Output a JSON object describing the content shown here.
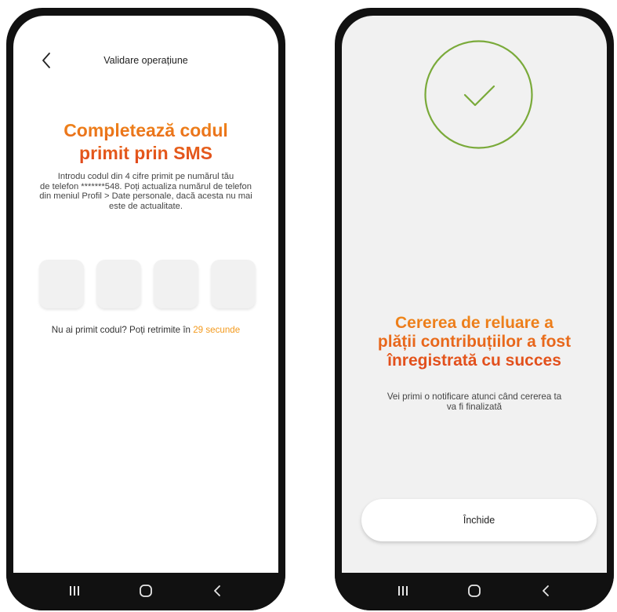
{
  "colors": {
    "accent_orange": "#f39a1e",
    "headline_top": "#f08a1a",
    "headline_bottom": "#e0461c",
    "success_green": "#7aaa3a",
    "otp_box_bg": "#f1f1f1"
  },
  "screen_otp": {
    "header_title": "Validare operațiune",
    "back_icon": "chevron-left-icon",
    "headline_line1": "Completează codul",
    "headline_line2": "primit prin SMS",
    "description_lines": [
      "Introdu codul din 4 cifre primit pe numărul tău",
      "de telefon *******548. Poți actualiza numărul de telefon",
      "din meniul Profil > Date personale, dacă acesta nu mai",
      "este de actualitate."
    ],
    "otp_digits": [
      "",
      "",
      "",
      ""
    ],
    "resend_text": "Nu ai primit codul? Poți retrimite în",
    "resend_countdown": "29 secunde"
  },
  "screen_success": {
    "success_icon": "checkmark-circle-icon",
    "headline_line1": "Cererea de reluare a",
    "headline_line2": "plății contribuțiilor a fost",
    "headline_line3": "înregistrată cu succes",
    "description_line1": "Vei primi o notificare atunci când cererea ta",
    "description_line2": "va fi finalizată",
    "close_button_label": "Închide"
  },
  "system_nav": {
    "recents_icon": "recent-apps-icon",
    "home_icon": "home-icon",
    "back_icon": "back-chevron-icon"
  }
}
